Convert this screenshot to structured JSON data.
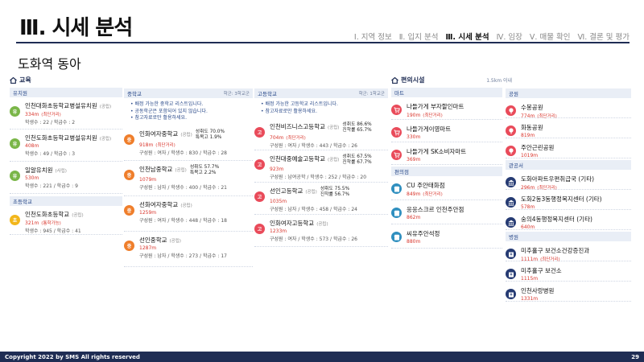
{
  "header": {
    "title": "Ⅲ. 시세 분석",
    "steps": [
      "Ⅰ. 지역 정보",
      "Ⅱ. 입지 분석",
      "Ⅲ. 시세 분석",
      "Ⅳ. 임장",
      "Ⅴ. 매물 확인",
      "Ⅵ. 결론 및 평가"
    ],
    "active_step": 2,
    "subtitle": "도화역 동아"
  },
  "education": {
    "title": "교육",
    "kindergarten": {
      "label": "유치원",
      "items": [
        {
          "badge": "유",
          "name": "인천대화초등학교병설유치원",
          "type": "(공립)",
          "dist": "334m",
          "near": "(최단거리)",
          "meta": "학생수 : 22 / 학급수 : 2"
        },
        {
          "badge": "유",
          "name": "인천도화초등학교병설유치원",
          "type": "(공립)",
          "dist": "408m",
          "near": "",
          "meta": "학생수 : 49 / 학급수 : 3"
        },
        {
          "badge": "유",
          "name": "일알유치원",
          "type": "(사립)",
          "dist": "530m",
          "near": "",
          "meta": "학생수 : 221 / 학급수 : 9"
        }
      ]
    },
    "elementary": {
      "label": "초등학교",
      "items": [
        {
          "badge": "초",
          "name": "인천도화초등학교",
          "type": "(공립)",
          "dist": "321m",
          "near": "(통학가능)",
          "meta": "학생수 : 945 / 학급수 : 41"
        }
      ]
    }
  },
  "middle": {
    "label": "중학교",
    "right": "학군: 3학교군",
    "notes": [
      "• 배정 가능한 중학교 리스트입니다.",
      "• 공동학군은 포함되어 있지 않습니다.",
      "• 참고자료로만 활용하세요."
    ],
    "items": [
      {
        "badge": "중",
        "name": "인화여자중학교",
        "type": "(공립)",
        "dist": "918m",
        "near": "(최단거리)",
        "meta": "구성원 : 여자 / 학생수 : 830 / 학급수 : 28",
        "s1": "성취도 70.0%",
        "s2": "특목고 1.9%"
      },
      {
        "badge": "중",
        "name": "인천남중학교",
        "type": "(공립)",
        "dist": "1079m",
        "near": "",
        "meta": "구성원 : 남자 / 학생수 : 400 / 학급수 : 21",
        "s1": "성취도 57.7%",
        "s2": "특목고 2.2%"
      },
      {
        "badge": "중",
        "name": "선화여자중학교",
        "type": "(공립)",
        "dist": "1259m",
        "near": "",
        "meta": "구성원 : 여자 / 학생수 : 448 / 학급수 : 18",
        "s1": "",
        "s2": ""
      },
      {
        "badge": "중",
        "name": "선인중학교",
        "type": "(공립)",
        "dist": "1287m",
        "near": "",
        "meta": "구성원 : 남자 / 학생수 : 273 / 학급수 : 17",
        "s1": "",
        "s2": ""
      }
    ]
  },
  "high": {
    "label": "고등학교",
    "right": "학군: 1학교군",
    "notes": [
      "• 배정 가능한 고등학교 리스트입니다.",
      "• 참고자료로만 활용하세요."
    ],
    "items": [
      {
        "badge": "고",
        "name": "인천비즈니스고등학교",
        "type": "(공립)",
        "dist": "704m",
        "near": "(최단거리)",
        "meta": "구성원 : 여자 / 학생수 : 443 / 학급수 : 26",
        "s1": "성취도 86.6%",
        "s2": "진학률 65.7%"
      },
      {
        "badge": "고",
        "name": "인천대중예술고등학교",
        "type": "(공립)",
        "dist": "923m",
        "near": "",
        "meta": "구성원 : 남여공학 / 학생수 : 252 / 학급수 : 20",
        "s1": "성취도 67.5%",
        "s2": "진학률 67.7%"
      },
      {
        "badge": "고",
        "name": "선인고등학교",
        "type": "(공립)",
        "dist": "1035m",
        "near": "",
        "meta": "구성원 : 남자 / 학생수 : 458 / 학급수 : 24",
        "s1": "성취도 75.5%",
        "s2": "진학률 56.7%"
      },
      {
        "badge": "고",
        "name": "인화여자고등학교",
        "type": "(공립)",
        "dist": "1233m",
        "near": "",
        "meta": "구성원 : 여자 / 학생수 : 573 / 학급수 : 26",
        "s1": "",
        "s2": ""
      }
    ]
  },
  "convenience": {
    "title": "편의시설",
    "range": "1.5km 이내",
    "mart": {
      "label": "마트",
      "items": [
        {
          "name": "나들가게 부자할인마트",
          "dist": "190m",
          "near": "(최단거리)"
        },
        {
          "name": "나들가게이영마트",
          "dist": "330m",
          "near": ""
        },
        {
          "name": "나들가게 SK소비자마트",
          "dist": "369m",
          "near": ""
        }
      ]
    },
    "store": {
      "label": "편의점",
      "items": [
        {
          "name": "CU 주안태화점",
          "dist": "849m",
          "near": "(최단거리)"
        },
        {
          "name": "응응스크르 인천주안점",
          "dist": "862m",
          "near": ""
        },
        {
          "name": "씨유주안석정",
          "dist": "880m",
          "near": ""
        }
      ]
    },
    "park": {
      "label": "공원",
      "items": [
        {
          "name": "수봉공원",
          "dist": "774m",
          "near": "(최단거리)"
        },
        {
          "name": "화동공원",
          "dist": "819m",
          "near": ""
        },
        {
          "name": "주안근린공원",
          "dist": "1019m",
          "near": ""
        }
      ]
    },
    "office": {
      "label": "관공서",
      "items": [
        {
          "name": "도화아파트우편취급국 (기타)",
          "dist": "296m",
          "near": "(최단거리)"
        },
        {
          "name": "도화2동3동행정복지센터 (기타)",
          "dist": "578m",
          "near": ""
        },
        {
          "name": "숭의4동행정복지센터 (기타)",
          "dist": "640m",
          "near": ""
        }
      ]
    },
    "hospital": {
      "label": "병원",
      "items": [
        {
          "name": "미추홀구 보건소건강증진과",
          "dist": "1111m",
          "near": "(최단거리)"
        },
        {
          "name": "미추홀구 보건소",
          "dist": "1115m",
          "near": ""
        },
        {
          "name": "인천사랑병원",
          "dist": "1331m",
          "near": ""
        }
      ]
    }
  },
  "footer": {
    "copyright": "Copyright 2022 by SMS All rights reserved",
    "page": "29"
  }
}
